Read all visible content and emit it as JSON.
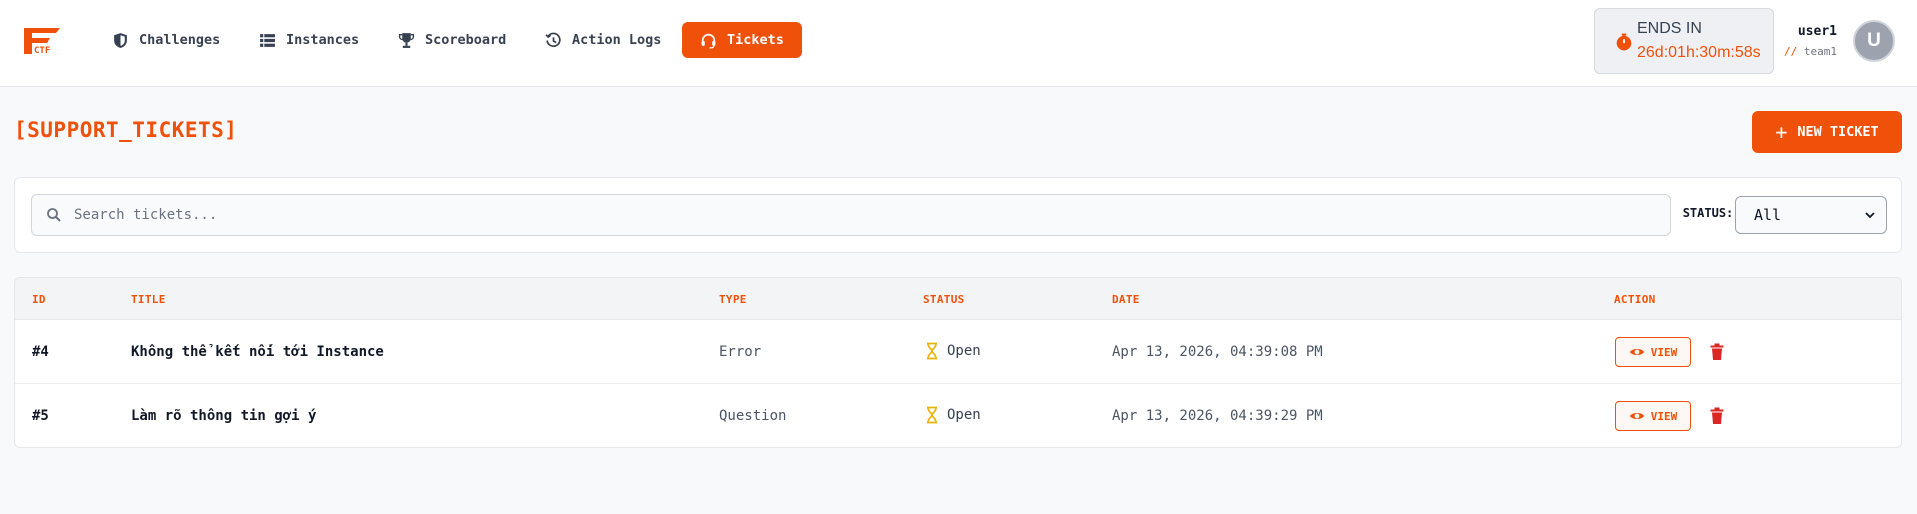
{
  "brand": {
    "logo_text": "CTF",
    "accent_color": "#f0510a"
  },
  "nav": {
    "items": [
      {
        "label": "Challenges",
        "icon": "shield-icon",
        "active": false
      },
      {
        "label": "Instances",
        "icon": "list-icon",
        "active": false
      },
      {
        "label": "Scoreboard",
        "icon": "trophy-icon",
        "active": false
      },
      {
        "label": "Action Logs",
        "icon": "history-icon",
        "active": false
      },
      {
        "label": "Tickets",
        "icon": "headset-icon",
        "active": true
      }
    ]
  },
  "timer": {
    "label": "ENDS IN",
    "value": "26d:01h:30m:58s",
    "icon": "stopwatch-icon"
  },
  "user": {
    "name": "user1",
    "team_prefix": "//",
    "team": "team1",
    "avatar_initial": "U"
  },
  "page": {
    "title": "[SUPPORT_TICKETS]",
    "new_ticket_label": "NEW TICKET"
  },
  "filters": {
    "search_placeholder": "Search tickets...",
    "status_label": "STATUS:",
    "status_selected": "All"
  },
  "table": {
    "headers": {
      "id": "ID",
      "title": "TITLE",
      "type": "TYPE",
      "status": "STATUS",
      "date": "DATE",
      "action": "ACTION"
    },
    "rows": [
      {
        "id": "#4",
        "title": "Không thể kết nối tới Instance",
        "type": "Error",
        "status": "Open",
        "date": "Apr 13, 2026, 04:39:08 PM",
        "view_label": "VIEW"
      },
      {
        "id": "#5",
        "title": "Làm rõ thông tin gợi ý",
        "type": "Question",
        "status": "Open",
        "date": "Apr 13, 2026, 04:39:29 PM",
        "view_label": "VIEW"
      }
    ]
  },
  "colors": {
    "accent": "#f0510a",
    "status_open": "#eab308",
    "delete": "#dc2626"
  }
}
